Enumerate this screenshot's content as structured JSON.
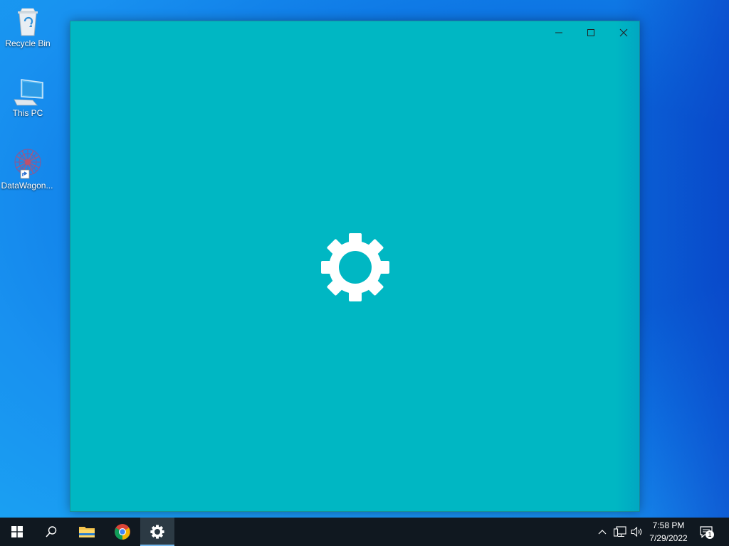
{
  "desktop": {
    "icons": [
      {
        "label": "Recycle Bin",
        "icon": "recycle-bin-icon"
      },
      {
        "label": "This PC",
        "icon": "computer-icon"
      },
      {
        "label": "DataWagon...",
        "icon": "datawagon-app-icon"
      }
    ]
  },
  "window": {
    "background_color": "#00b7c3",
    "controls": {
      "minimize": "minimize-icon",
      "maximize": "maximize-icon",
      "close": "close-icon"
    },
    "splash_icon": "gear-icon"
  },
  "taskbar": {
    "buttons": [
      {
        "name": "start",
        "icon": "windows-logo-icon"
      },
      {
        "name": "search",
        "icon": "search-icon"
      },
      {
        "name": "file-explorer",
        "icon": "folder-icon"
      },
      {
        "name": "chrome",
        "icon": "chrome-icon"
      },
      {
        "name": "settings",
        "icon": "gear-icon",
        "active": true
      }
    ],
    "tray": {
      "icons": [
        "chevron-up-icon",
        "network-icon",
        "volume-icon"
      ],
      "time": "7:58 PM",
      "date": "7/29/2022",
      "notification_count": "1"
    }
  }
}
